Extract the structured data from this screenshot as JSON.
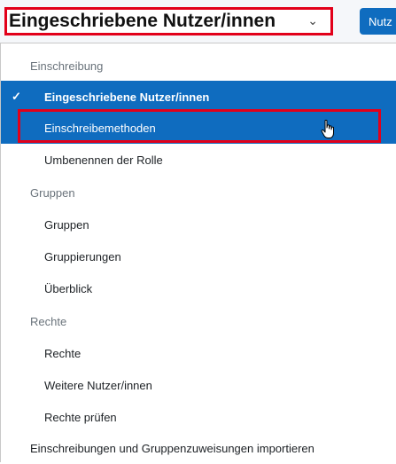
{
  "select": {
    "value": "Eingeschriebene Nutzer/innen",
    "chevron_icon": "chevron-down-icon"
  },
  "header_button": {
    "label": "Nutz"
  },
  "menu": {
    "group1": {
      "label": "Einschreibung",
      "items": [
        {
          "label": "Eingeschriebene Nutzer/innen",
          "state": "selected",
          "icon": "check-icon"
        },
        {
          "label": "Einschreibemethoden",
          "state": "hovered"
        },
        {
          "label": "Umbenennen der Rolle"
        }
      ]
    },
    "group2": {
      "label": "Gruppen",
      "items": [
        {
          "label": "Gruppen"
        },
        {
          "label": "Gruppierungen"
        },
        {
          "label": "Überblick"
        }
      ]
    },
    "group3": {
      "label": "Rechte",
      "items": [
        {
          "label": "Rechte"
        },
        {
          "label": "Weitere Nutzer/innen"
        },
        {
          "label": "Rechte prüfen"
        }
      ]
    },
    "import_item": {
      "label": "Einschreibungen und Gruppenzuweisungen importieren"
    }
  },
  "colors": {
    "accent": "#0f6cbf",
    "highlight": "#e2001a",
    "group_label": "#6a737b"
  }
}
